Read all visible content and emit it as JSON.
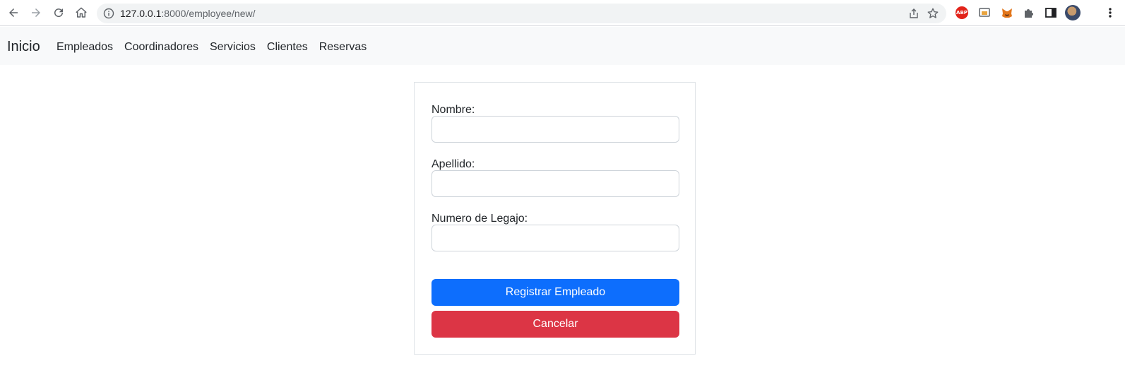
{
  "browser": {
    "url_host": "127.0.0.1",
    "url_rest": ":8000/employee/new/",
    "extensions": [
      "adblock-plus-icon",
      "cast-icon",
      "metamask-icon",
      "puzzle-extensions-icon",
      "side-panel-icon"
    ],
    "abp_label": "ABP"
  },
  "navbar": {
    "brand": "Inicio",
    "links": [
      "Empleados",
      "Coordinadores",
      "Servicios",
      "Clientes",
      "Reservas"
    ]
  },
  "form": {
    "fields": [
      {
        "label": "Nombre:",
        "value": ""
      },
      {
        "label": "Apellido:",
        "value": ""
      },
      {
        "label": "Numero de Legajo:",
        "value": ""
      }
    ],
    "submit_label": "Registrar Empleado",
    "cancel_label": "Cancelar"
  },
  "colors": {
    "primary": "#0d6efd",
    "danger": "#dc3545",
    "navbar_bg": "#f8f9fa"
  }
}
